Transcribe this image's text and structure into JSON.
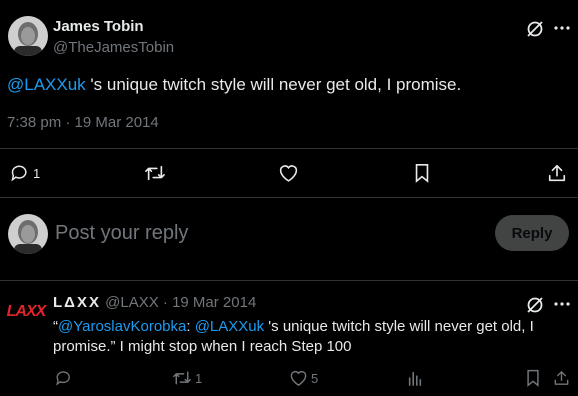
{
  "main_tweet": {
    "author_name": "James Tobin",
    "author_handle": "@TheJamesTobin",
    "mention": "@LAXXuk",
    "text_rest": " 's unique twitch style will never get old, I promise.",
    "timestamp": "7:38 pm · 19 Mar 2014",
    "actions": {
      "reply_count": "1",
      "retweet_count": "",
      "like_count": ""
    }
  },
  "composer": {
    "placeholder": "Post your reply",
    "reply_label": "Reply"
  },
  "reply_tweet": {
    "author_name": "LΔXX",
    "author_handle": "@LAXX",
    "date": "· 19 Mar 2014",
    "text_quote_open": "“",
    "mention_1": "@YaroslavKorobka",
    "text_sep": ": ",
    "mention_2": "@LAXXuk",
    "text_line1_rest": " 's unique twitch style will never get old, I",
    "text_line2": "promise.” I might stop when I reach Step 100",
    "actions": {
      "retweet_count": "1",
      "like_count": "5"
    },
    "avatar_logo_text": "LAXX"
  },
  "colors": {
    "link": "#1d9bf0",
    "muted": "#71767b",
    "text": "#e7e9ea",
    "logo_red": "#e0242a"
  }
}
